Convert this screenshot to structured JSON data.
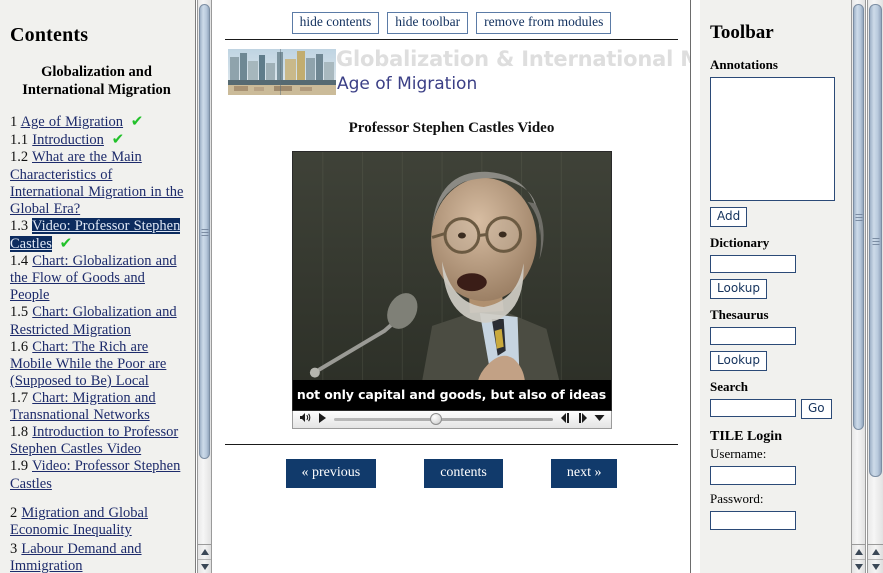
{
  "sidebar": {
    "heading": "Contents",
    "module_title": "Globalization and International Migration",
    "toc": [
      {
        "num": "1",
        "label": "Age of Migration",
        "level": 1,
        "done": true,
        "selected": false
      },
      {
        "num": "1.1",
        "label": "Introduction",
        "level": 2,
        "done": true,
        "selected": false
      },
      {
        "num": "1.2",
        "label": "What are the Main Characteristics of International Migration in the Global Era?",
        "level": 2,
        "done": false,
        "selected": false
      },
      {
        "num": "1.3",
        "label": "Video: Professor Stephen Castles",
        "level": 2,
        "done": true,
        "selected": true
      },
      {
        "num": "1.4",
        "label": "Chart: Globalization and the Flow of Goods and People",
        "level": 2,
        "done": false,
        "selected": false
      },
      {
        "num": "1.5",
        "label": "Chart: Globalization and Restricted Migration",
        "level": 2,
        "done": false,
        "selected": false
      },
      {
        "num": "1.6",
        "label": "Chart: The Rich are Mobile While the Poor are (Supposed to Be) Local",
        "level": 2,
        "done": false,
        "selected": false
      },
      {
        "num": "1.7",
        "label": "Chart: Migration and Transnational Networks",
        "level": 2,
        "done": false,
        "selected": false
      },
      {
        "num": "1.8",
        "label": "Introduction to Professor Stephen Castles Video",
        "level": 2,
        "done": false,
        "selected": false
      },
      {
        "num": "1.9",
        "label": "Video: Professor Stephen Castles",
        "level": 2,
        "done": false,
        "selected": false
      },
      {
        "num": "2",
        "label": "Migration and Global Economic Inequality",
        "level": 1,
        "done": false,
        "selected": false,
        "spaced": true
      },
      {
        "num": "3",
        "label": "Labour Demand and Immigration",
        "level": 1,
        "done": false,
        "selected": false
      }
    ],
    "checkmark": "✔"
  },
  "topbar": {
    "hide_contents": "hide contents",
    "hide_toolbar": "hide toolbar",
    "remove_from_modules": "remove from modules"
  },
  "banner": {
    "title": "Globalization & International Migra",
    "subtitle": "Age of Migration",
    "photo_alt": "city-construction-banner-image"
  },
  "content": {
    "page_title": "Professor Stephen Castles Video",
    "video": {
      "caption": "not only capital and goods, but also of ideas",
      "volume_icon": "◂))",
      "play_icon": "▶",
      "step_back_icon": "⏪",
      "step_forward_icon": "⏩",
      "menu_icon": "▼",
      "scrub_position_percent": 44
    },
    "nav": {
      "previous": "« previous",
      "contents": "contents",
      "next": "next »"
    }
  },
  "toolbar": {
    "title": "Toolbar",
    "annotations_label": "Annotations",
    "annotations_value": "",
    "add_button": "Add",
    "dictionary_label": "Dictionary",
    "dictionary_value": "",
    "dictionary_lookup_button": "Lookup",
    "thesaurus_label": "Thesaurus",
    "thesaurus_value": "",
    "thesaurus_lookup_button": "Lookup",
    "search_label": "Search",
    "search_value": "",
    "search_go_button": "Go",
    "tile_login_label": "TILE Login",
    "username_label": "Username:",
    "username_value": "",
    "password_label": "Password:",
    "password_value": ""
  },
  "colors": {
    "selection_bg": "#0c2b5e",
    "link": "#1d2b6b",
    "nav_button_bg": "#113a6b",
    "checkmark_green": "#22c12a",
    "panel_bg": "#f1f1ee",
    "banner_title_gray": "#dedede",
    "banner_subtitle_blue": "#3b3f86"
  }
}
